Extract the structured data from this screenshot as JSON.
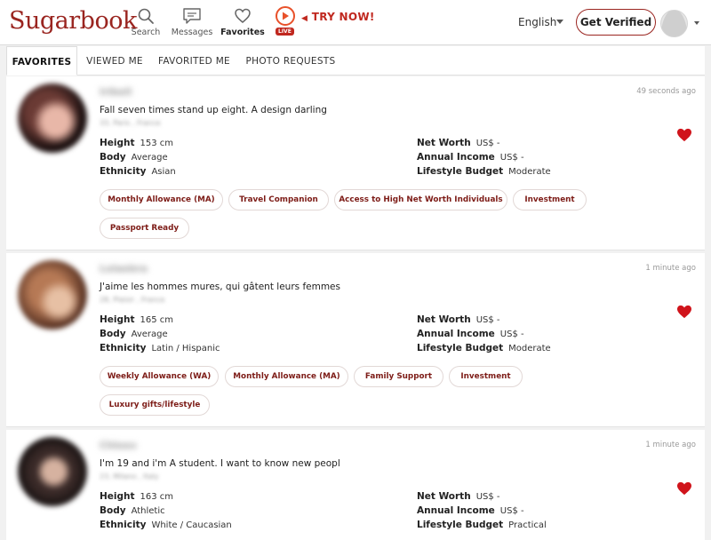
{
  "header": {
    "logo": "Sugarbook",
    "nav": [
      {
        "label": "Search",
        "icon": "search-icon"
      },
      {
        "label": "Messages",
        "icon": "message-icon"
      },
      {
        "label": "Favorites",
        "icon": "heart-outline-icon"
      }
    ],
    "live_badge": "LIVE",
    "try_now": "TRY NOW!",
    "language": "English",
    "verify_label": "Get Verified"
  },
  "tabs": [
    {
      "label": "FAVORITES",
      "active": true
    },
    {
      "label": "VIEWED ME",
      "active": false
    },
    {
      "label": "FAVORITED ME",
      "active": false
    },
    {
      "label": "PHOTO REQUESTS",
      "active": false
    }
  ],
  "colors": {
    "brand": "#9a2520",
    "heart": "#d0141b",
    "tag_text": "#7d1c17"
  },
  "profiles": [
    {
      "name": "Iribell",
      "time": "49 seconds ago",
      "headline": "Fall seven times stand up eight. A design darling",
      "location": "33, Paris , France",
      "height_label": "Height",
      "height": "153 cm",
      "body_label": "Body",
      "body": "Average",
      "ethnicity_label": "Ethnicity",
      "ethnicity": "Asian",
      "networth_label": "Net Worth",
      "networth": "US$ -",
      "income_label": "Annual Income",
      "income": "US$ -",
      "budget_label": "Lifestyle Budget",
      "budget": "Moderate",
      "tags": [
        "Monthly Allowance (MA)",
        "Travel Companion",
        "Access to High Net Worth Individuals",
        "Investment",
        "Passport Ready"
      ]
    },
    {
      "name": "Lolaebra",
      "time": "1 minute ago",
      "headline": "J'aime les hommes mures, qui gâtent leurs femmes",
      "location": "28, Plaisir , France",
      "height_label": "Height",
      "height": "165 cm",
      "body_label": "Body",
      "body": "Average",
      "ethnicity_label": "Ethnicity",
      "ethnicity": "Latin / Hispanic",
      "networth_label": "Net Worth",
      "networth": "US$ -",
      "income_label": "Annual Income",
      "income": "US$ -",
      "budget_label": "Lifestyle Budget",
      "budget": "Moderate",
      "tags": [
        "Weekly Allowance (WA)",
        "Monthly Allowance (MA)",
        "Family Support",
        "Investment",
        "Luxury gifts/lifestyle"
      ]
    },
    {
      "name": "Chloex",
      "time": "1 minute ago",
      "headline": "I'm 19 and i'm A student. I want to know new peopl",
      "location": "23, Milano , Italy",
      "height_label": "Height",
      "height": "163 cm",
      "body_label": "Body",
      "body": "Athletic",
      "ethnicity_label": "Ethnicity",
      "ethnicity": "White / Caucasian",
      "networth_label": "Net Worth",
      "networth": "US$ -",
      "income_label": "Annual Income",
      "income": "US$ -",
      "budget_label": "Lifestyle Budget",
      "budget": "Practical",
      "tags": []
    }
  ]
}
